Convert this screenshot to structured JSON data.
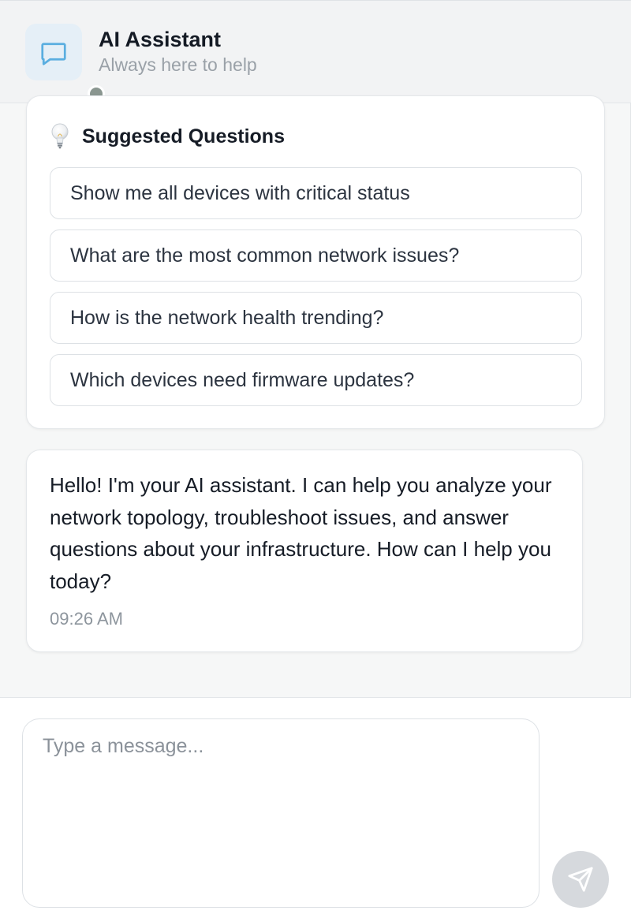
{
  "header": {
    "title": "AI Assistant",
    "subtitle": "Always here to help",
    "icon": "chat-bubble-icon",
    "status": "offline"
  },
  "suggestions": {
    "title": "Suggested Questions",
    "icon": "lightbulb-icon",
    "items": [
      "Show me all devices with critical status",
      "What are the most common network issues?",
      "How is the network health trending?",
      "Which devices need firmware updates?"
    ]
  },
  "messages": [
    {
      "text": "Hello! I'm your AI assistant. I can help you analyze your network topology, troubleshoot issues, and answer questions about your infrastructure. How can I help you today?",
      "time": "09:26 AM"
    }
  ],
  "composer": {
    "placeholder": "Type a message...",
    "value": "",
    "send_icon": "send-icon"
  },
  "colors": {
    "accent": "#5aaee0",
    "status_dot": "#8a9690",
    "send_button_disabled": "#d6d9dd"
  }
}
